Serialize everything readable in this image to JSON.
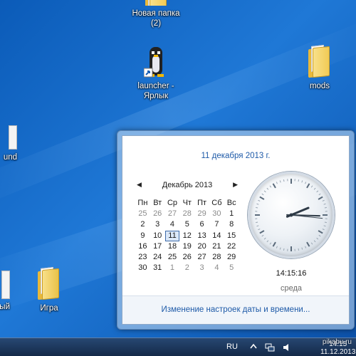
{
  "desktop": {
    "icons": [
      {
        "label": "Новая папка\n(2)"
      },
      {
        "label": "launcher -\nЯрлык"
      },
      {
        "label": "mods"
      },
      {
        "label": "und"
      },
      {
        "label": "Игра"
      },
      {
        "label": "ый"
      }
    ]
  },
  "flyout": {
    "date_link": "11 декабря 2013 г.",
    "calendar": {
      "month_label": "Декабрь 2013",
      "prev_arrow": "◀",
      "next_arrow": "▶",
      "weekdays": [
        "Пн",
        "Вт",
        "Ср",
        "Чт",
        "Пт",
        "Сб",
        "Вс"
      ],
      "weeks": [
        [
          "25",
          "26",
          "27",
          "28",
          "29",
          "30",
          "1"
        ],
        [
          "2",
          "3",
          "4",
          "5",
          "6",
          "7",
          "8"
        ],
        [
          "9",
          "10",
          "11",
          "12",
          "13",
          "14",
          "15"
        ],
        [
          "16",
          "17",
          "18",
          "19",
          "20",
          "21",
          "22"
        ],
        [
          "23",
          "24",
          "25",
          "26",
          "27",
          "28",
          "29"
        ],
        [
          "30",
          "31",
          "1",
          "2",
          "3",
          "4",
          "5"
        ]
      ],
      "selected_day": "11"
    },
    "clock": {
      "time": "14:15:16",
      "day_of_week": "среда",
      "hour": 14,
      "minute": 15,
      "second": 16
    },
    "settings_link": "Изменение настроек даты и времени..."
  },
  "taskbar": {
    "language": "RU",
    "time": "14:15",
    "date": "11.12.2013"
  },
  "watermark": "pikabu.ru"
}
